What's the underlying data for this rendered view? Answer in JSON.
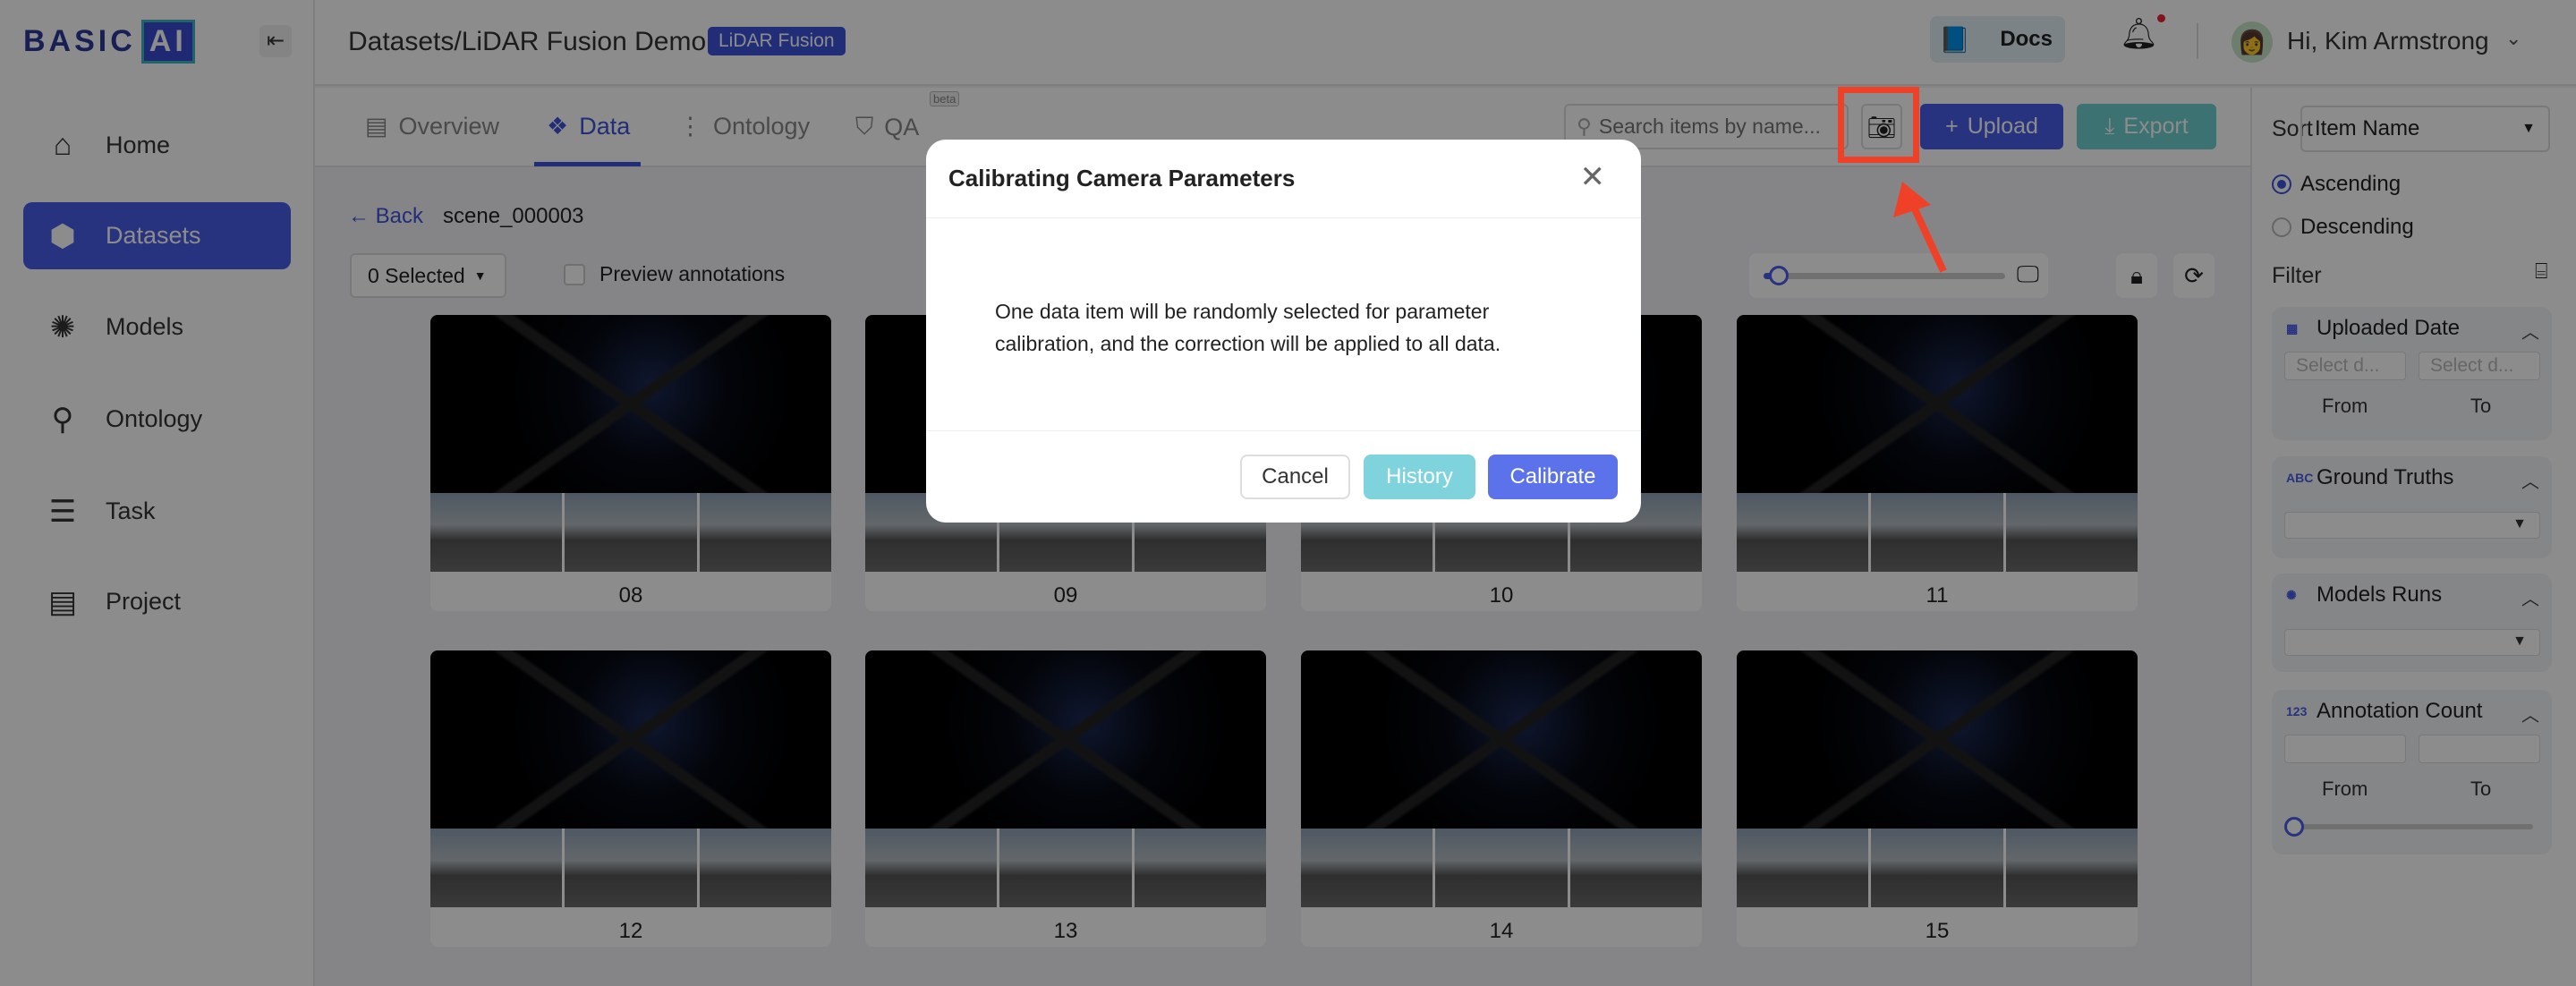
{
  "brand": {
    "logo_text": "BASIC",
    "logo_ai": "AI"
  },
  "sidebar": {
    "items": [
      {
        "label": "Home",
        "icon": "home-icon",
        "glyph": "⌂"
      },
      {
        "label": "Datasets",
        "icon": "datasets-icon",
        "glyph": "⬢",
        "active": true
      },
      {
        "label": "Models",
        "icon": "brain-icon",
        "glyph": "✺"
      },
      {
        "label": "Ontology",
        "icon": "hierarchy-icon",
        "glyph": "⚲"
      },
      {
        "label": "Task",
        "icon": "clipboard-icon",
        "glyph": "☰"
      },
      {
        "label": "Project",
        "icon": "folder-icon",
        "glyph": "▤"
      }
    ]
  },
  "header": {
    "title": "Datasets/LiDAR Fusion Demo",
    "badge": "LiDAR Fusion",
    "docs": "Docs",
    "user": "Hi, Kim Armstrong"
  },
  "tabs": [
    {
      "label": "Overview"
    },
    {
      "label": "Data",
      "active": true
    },
    {
      "label": "Ontology"
    },
    {
      "label": "QA",
      "badge": "beta"
    }
  ],
  "toolbar": {
    "search_placeholder": "Search items by name...",
    "upload": "Upload",
    "export": "Export"
  },
  "scene": {
    "back": "Back",
    "name": "scene_000003",
    "selected": "0 Selected",
    "preview": "Preview annotations",
    "zoom_slider": 0.05
  },
  "cards": [
    {
      "label": "08"
    },
    {
      "label": "09"
    },
    {
      "label": "10"
    },
    {
      "label": "11"
    },
    {
      "label": "12"
    },
    {
      "label": "13"
    },
    {
      "label": "14"
    },
    {
      "label": "15"
    }
  ],
  "right": {
    "sort_label": "Sort",
    "sort_value": "Item Name",
    "ascending": "Ascending",
    "descending": "Descending",
    "sort_order": "Ascending",
    "filter": "Filter",
    "uploaded_date": {
      "title": "Uploaded Date",
      "from_placeholder": "Select d...",
      "to_placeholder": "Select d...",
      "from": "From",
      "to": "To"
    },
    "ground_truths": {
      "title": "Ground Truths",
      "icon": "ABC"
    },
    "models_runs": {
      "title": "Models Runs"
    },
    "annotation_count": {
      "title": "Annotation Count",
      "icon": "123",
      "from": "From",
      "to": "To"
    }
  },
  "modal": {
    "title": "Calibrating Camera Parameters",
    "body": "One data item will be randomly selected for parameter calibration, and the correction will be applied to all data.",
    "cancel": "Cancel",
    "history": "History",
    "calibrate": "Calibrate"
  },
  "colors": {
    "accent": "#4a5ee8",
    "teal": "#6ecfcf",
    "highlight": "#ee4128"
  }
}
